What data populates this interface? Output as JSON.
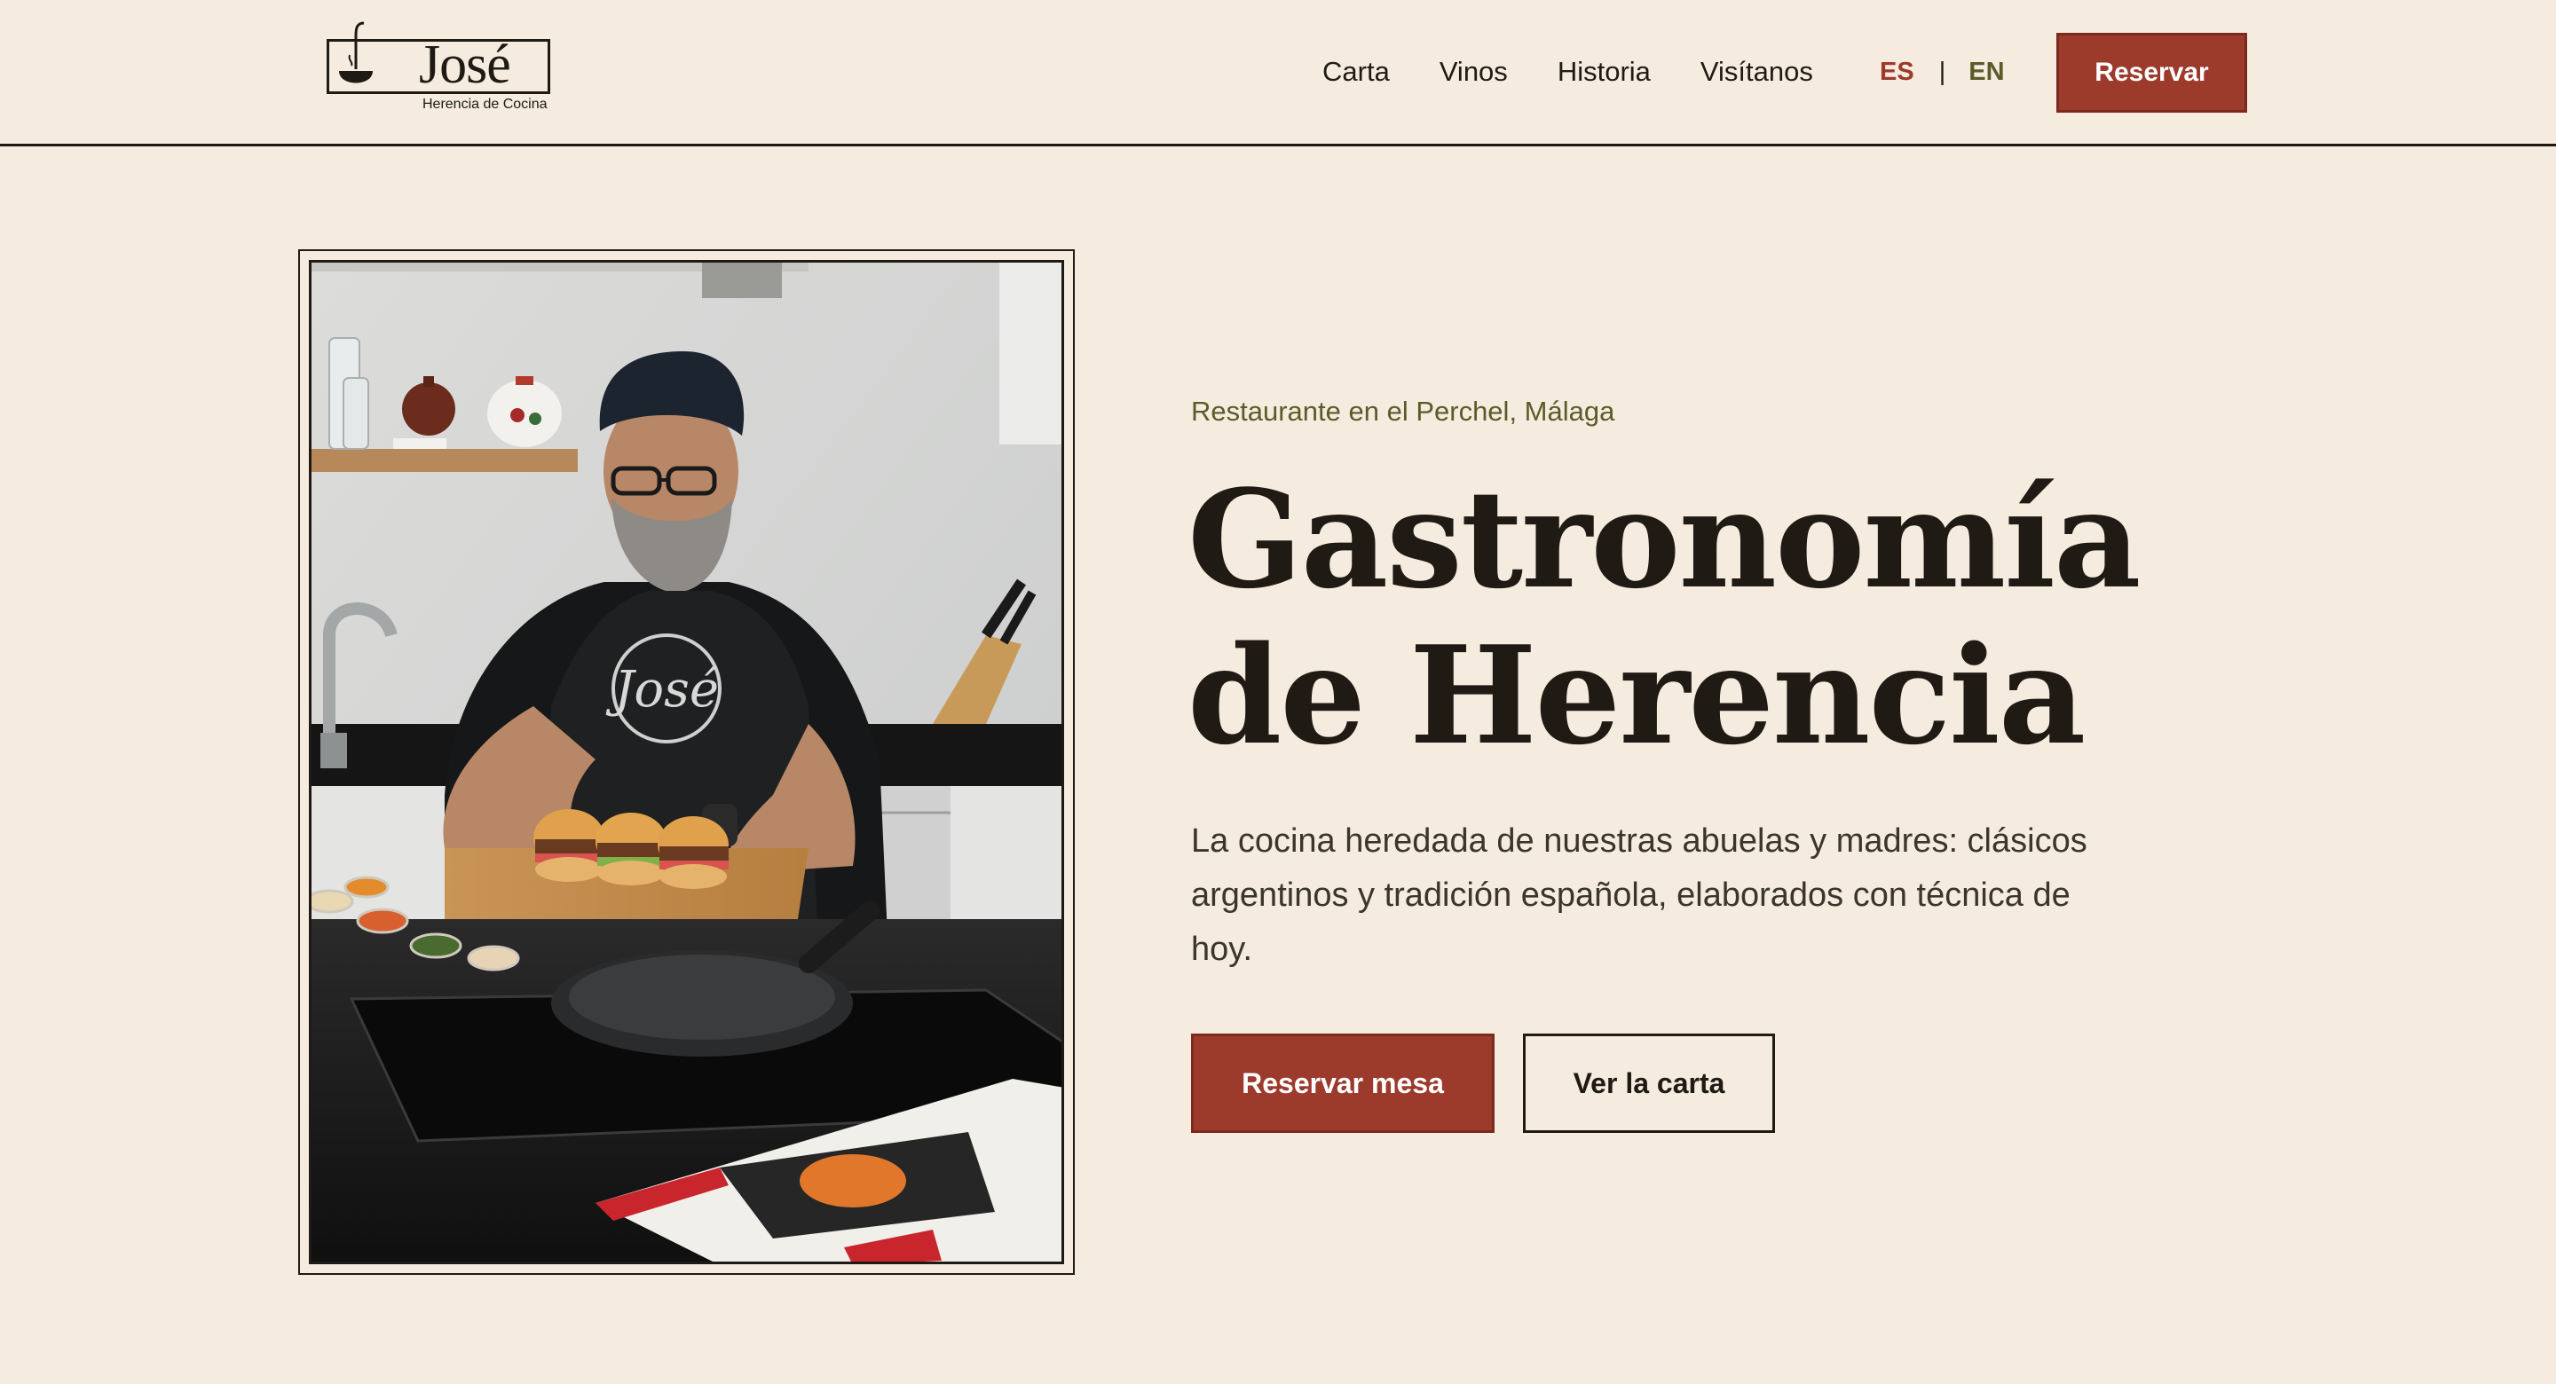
{
  "brand": {
    "name": "José",
    "tagline": "Herencia de Cocina",
    "logo_icon": "ladle-icon"
  },
  "nav": {
    "items": [
      "Carta",
      "Vinos",
      "Historia",
      "Visítanos"
    ]
  },
  "language": {
    "active": "ES",
    "separator": "|",
    "other": "EN"
  },
  "header": {
    "cta_label": "Reservar"
  },
  "hero": {
    "eyebrow": "Restaurante en el Perchel, Málaga",
    "title_line1": "Gastronomía",
    "title_line2": "de Herencia",
    "description": "La cocina heredada de nuestras abuelas y madres: clásicos argentinos y tradición española, elaborados con técnica de hoy.",
    "primary_cta": "Reservar mesa",
    "secondary_cta": "Ver la carta",
    "apron_text": "José"
  },
  "colors": {
    "background": "#f5ecdf",
    "accent": "#9c3a2c",
    "text": "#1f1a14",
    "olive": "#5d5a2a"
  }
}
